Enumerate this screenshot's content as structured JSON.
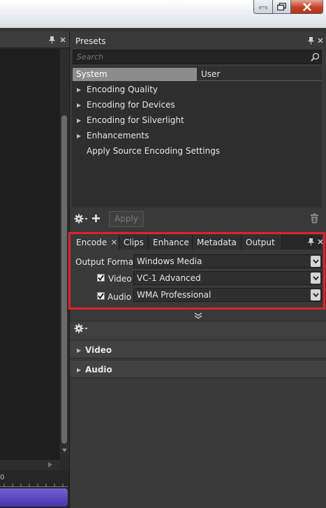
{
  "window": {
    "buttons": [
      "minimize-icon",
      "maximize-icon",
      "close-icon"
    ]
  },
  "presets": {
    "title": "Presets",
    "search_placeholder": "Search",
    "tabs": [
      "System",
      "User"
    ],
    "items": [
      {
        "label": "Encoding Quality",
        "expandable": true
      },
      {
        "label": "Encoding for Devices",
        "expandable": true
      },
      {
        "label": "Encoding for Silverlight",
        "expandable": true
      },
      {
        "label": "Enhancements",
        "expandable": true
      },
      {
        "label": "Apply Source Encoding Settings",
        "expandable": false
      }
    ],
    "apply_label": "Apply"
  },
  "encode": {
    "tabs": [
      "Encode",
      "Clips",
      "Enhance",
      "Metadata",
      "Output"
    ],
    "output_format_label": "Output Format",
    "output_format_value": "Windows Media",
    "video_label": "Video",
    "video_checked": true,
    "video_value": "VC-1 Advanced",
    "audio_label": "Audio",
    "audio_checked": true,
    "audio_value": "WMA Professional"
  },
  "sections": [
    "Video",
    "Audio"
  ],
  "timeline": {
    "start": "0"
  },
  "colors": {
    "highlight": "#e0222d",
    "selected_tab": "#8c8c8c",
    "timeline_bar": "#5b4bc4"
  }
}
